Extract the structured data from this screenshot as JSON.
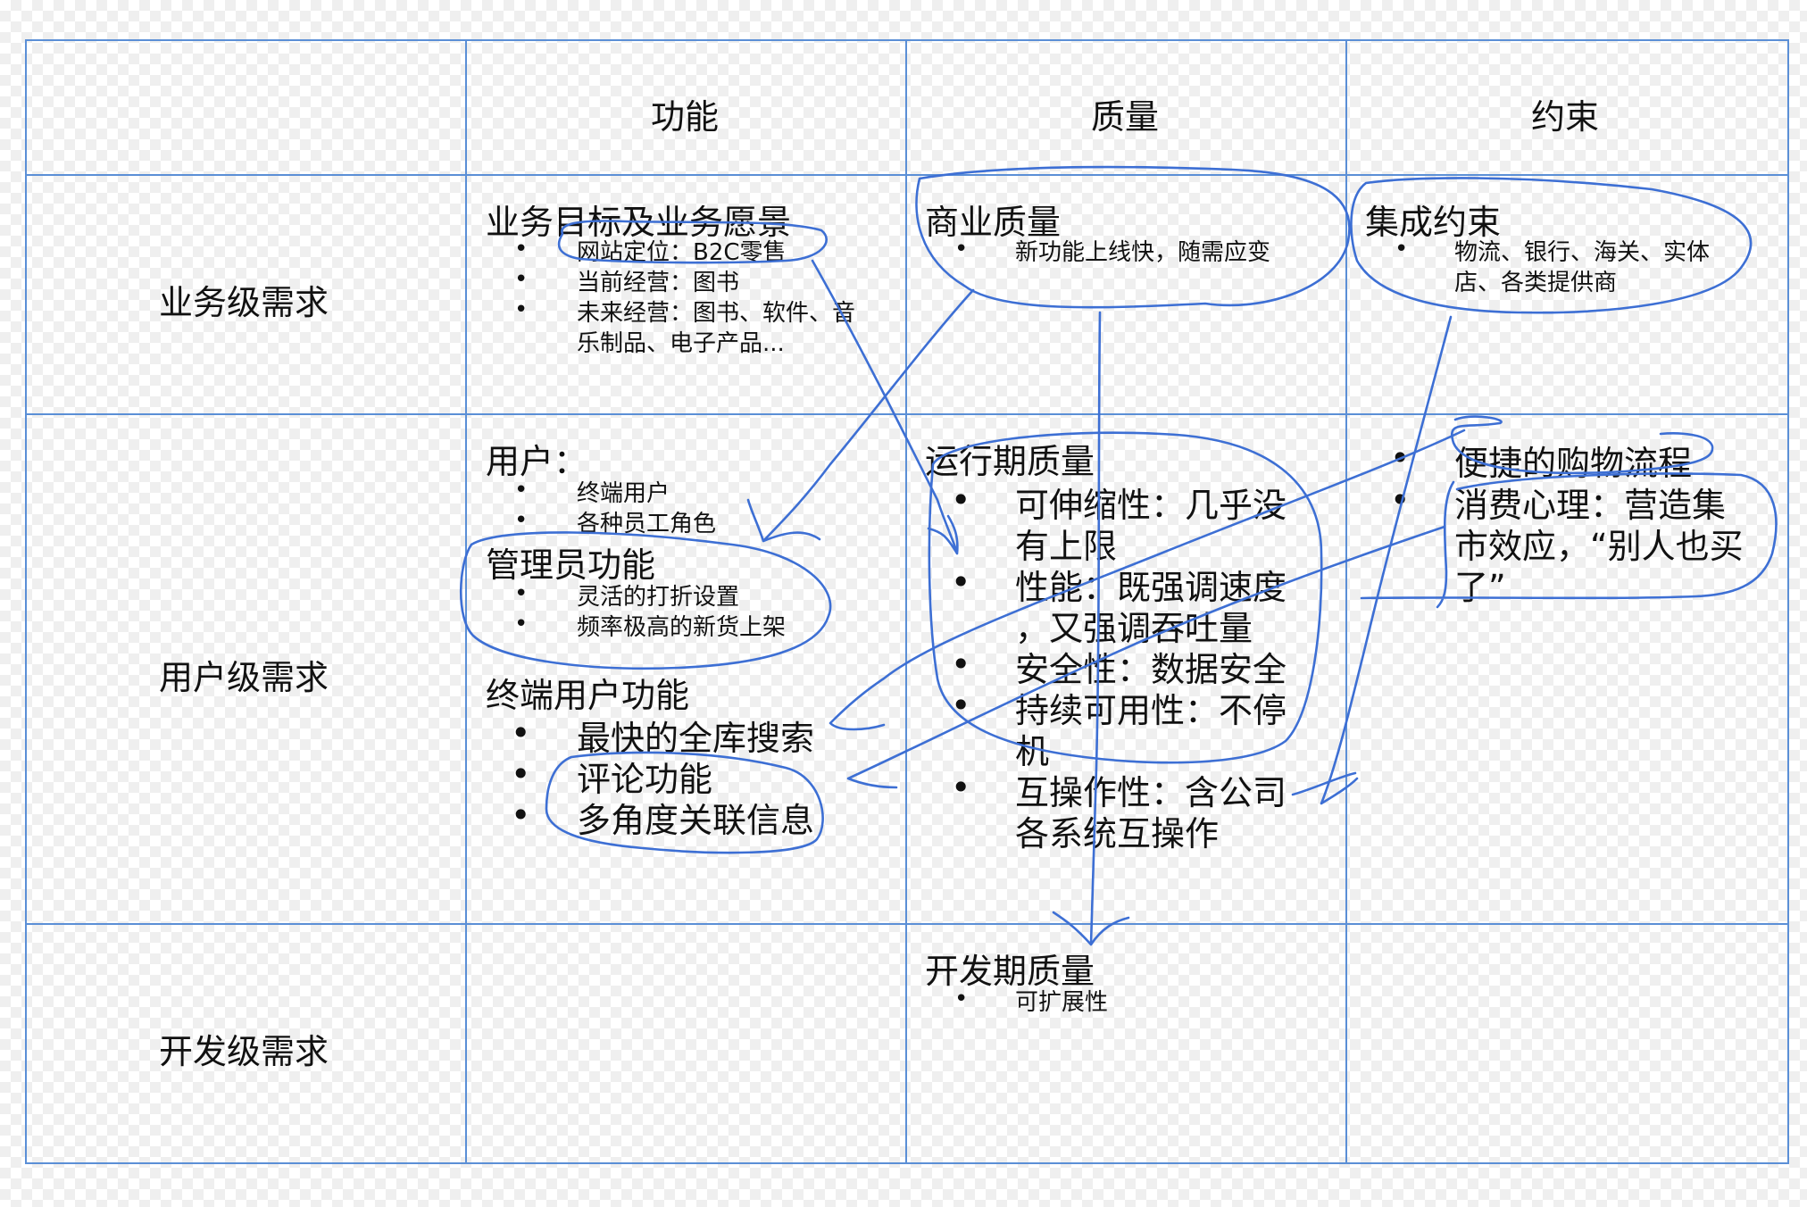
{
  "table": {
    "columns": [
      "功能",
      "质量",
      "约束"
    ],
    "rows": [
      "业务级需求",
      "用户级需求",
      "开发级需求"
    ]
  },
  "cells": {
    "business_function": {
      "title": "业务目标及业务愿景",
      "items": [
        "网站定位：B2C零售",
        "当前经营：图书",
        "未来经营：图书、软件、音",
        "乐制品、电子产品..."
      ]
    },
    "business_quality": {
      "title": "商业质量",
      "items": [
        "新功能上线快，随需应变"
      ]
    },
    "business_constraint": {
      "title": "集成约束",
      "items": [
        "物流、银行、海关、实体",
        "店、各类提供商"
      ]
    },
    "user_function": {
      "users_title": "用户：",
      "users_items": [
        "终端用户",
        "各种员工角色"
      ],
      "admin_title": "管理员功能",
      "admin_items": [
        "灵活的打折设置",
        "频率极高的新货上架"
      ],
      "enduser_title": "终端用户功能",
      "enduser_items": [
        "最快的全库搜索",
        "评论功能",
        "多角度关联信息"
      ]
    },
    "user_quality": {
      "title": "运行期质量",
      "lines": [
        "可伸缩性：几乎没",
        "有上限",
        "性能：既强调速度",
        "，又强调吞吐量",
        "安全性：数据安全",
        "持续可用性：不停",
        "机",
        "互操作性：含公司",
        "各系统互操作"
      ]
    },
    "user_constraint": {
      "lines": [
        "便捷的购物流程",
        "消费心理：营造集",
        "市效应，“别人也买",
        "了”"
      ]
    },
    "dev_quality": {
      "title": "开发期质量",
      "items": [
        "可扩展性"
      ]
    }
  },
  "bullet_char": "•",
  "colors": {
    "grid": "#5b8fd6",
    "ink": "#3d6fd4",
    "text": "#111111"
  }
}
